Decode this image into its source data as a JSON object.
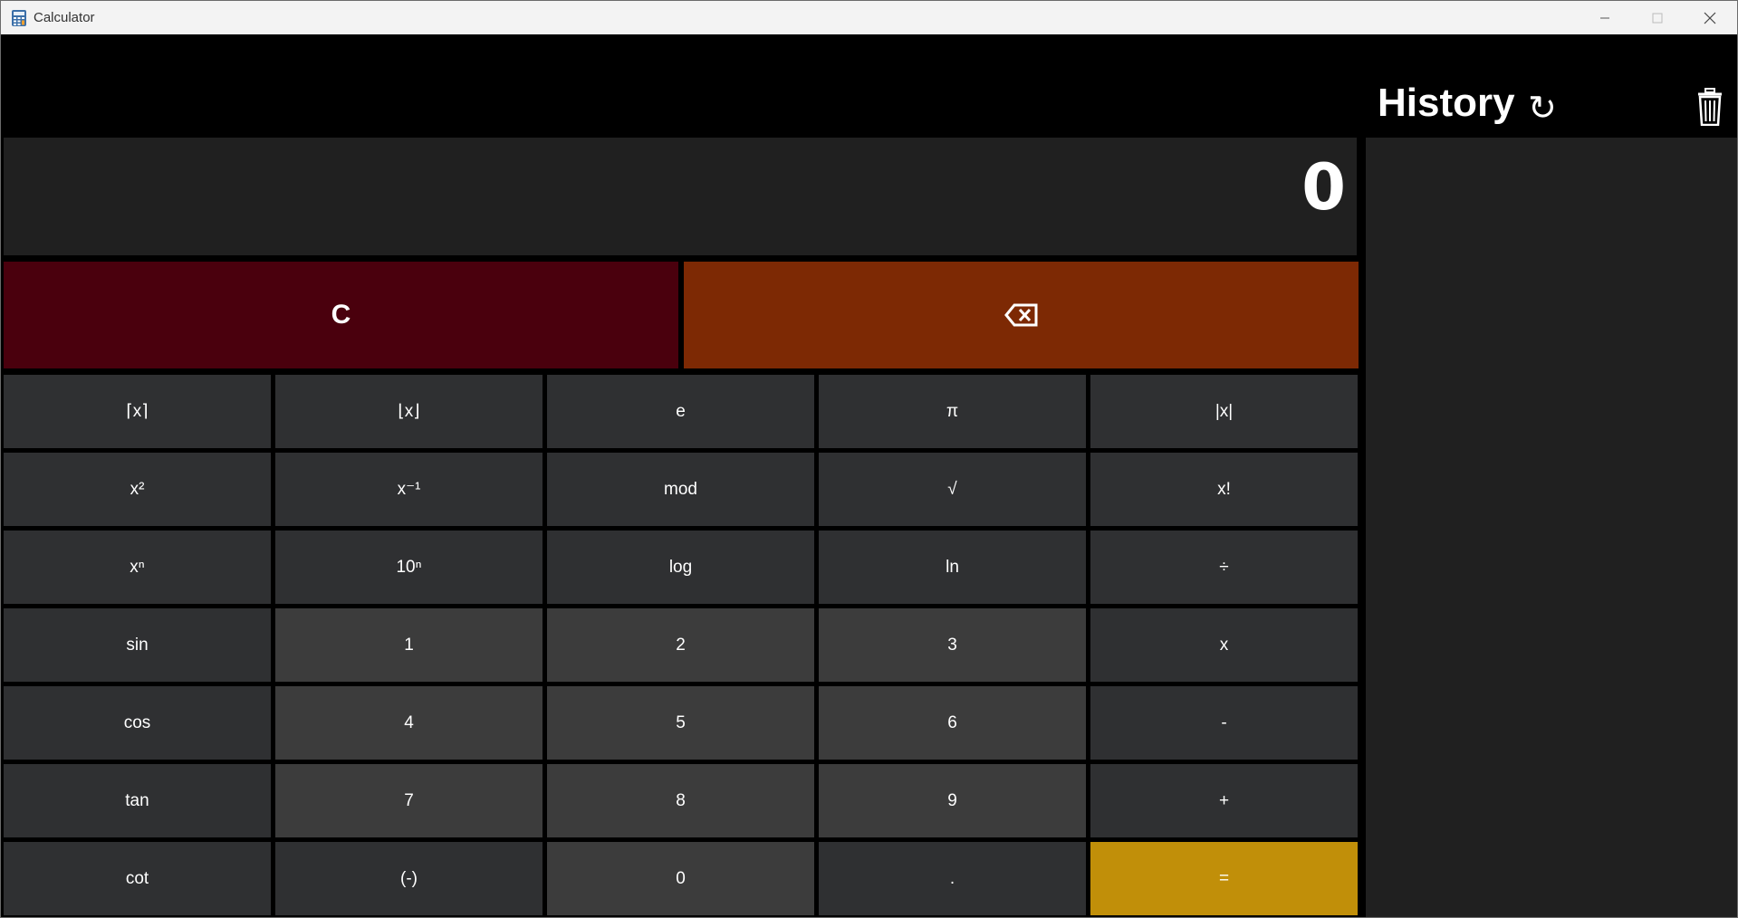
{
  "window": {
    "title": "Calculator",
    "minimize_icon": "minimize-icon",
    "maximize_icon": "maximize-icon",
    "close_icon": "close-icon"
  },
  "display": {
    "value": "0"
  },
  "controls": {
    "clear_label": "C",
    "backspace_label": "⌫"
  },
  "keypad": [
    {
      "label": "⌈x⌉",
      "type": "fn"
    },
    {
      "label": "⌊x⌋",
      "type": "fn"
    },
    {
      "label": "e",
      "type": "fn"
    },
    {
      "label": "π",
      "type": "fn"
    },
    {
      "label": "|x|",
      "type": "fn"
    },
    {
      "label": "x²",
      "type": "fn"
    },
    {
      "label": "x⁻¹",
      "type": "fn"
    },
    {
      "label": "mod",
      "type": "fn"
    },
    {
      "label": "√",
      "type": "fn"
    },
    {
      "label": "x!",
      "type": "fn"
    },
    {
      "label": "xⁿ",
      "type": "fn"
    },
    {
      "label": "10ⁿ",
      "type": "fn"
    },
    {
      "label": "log",
      "type": "fn"
    },
    {
      "label": "ln",
      "type": "fn"
    },
    {
      "label": "÷",
      "type": "fn"
    },
    {
      "label": "sin",
      "type": "fn"
    },
    {
      "label": "1",
      "type": "num"
    },
    {
      "label": "2",
      "type": "num"
    },
    {
      "label": "3",
      "type": "num"
    },
    {
      "label": "x",
      "type": "fn"
    },
    {
      "label": "cos",
      "type": "fn"
    },
    {
      "label": "4",
      "type": "num"
    },
    {
      "label": "5",
      "type": "num"
    },
    {
      "label": "6",
      "type": "num"
    },
    {
      "label": "-",
      "type": "fn"
    },
    {
      "label": "tan",
      "type": "fn"
    },
    {
      "label": "7",
      "type": "num"
    },
    {
      "label": "8",
      "type": "num"
    },
    {
      "label": "9",
      "type": "num"
    },
    {
      "label": "+",
      "type": "fn"
    },
    {
      "label": "cot",
      "type": "fn"
    },
    {
      "label": "(-)",
      "type": "fn"
    },
    {
      "label": "0",
      "type": "num"
    },
    {
      "label": ".",
      "type": "fn"
    },
    {
      "label": "=",
      "type": "equals"
    }
  ],
  "history": {
    "title": "History",
    "refresh_icon": "↻",
    "trash_icon": "trash-icon"
  },
  "colors": {
    "clear": "#4a000d",
    "backspace": "#7d2904",
    "equals": "#c18f09",
    "fn_key": "#2f3032",
    "num_key": "#3c3c3c",
    "panel": "#202020"
  }
}
